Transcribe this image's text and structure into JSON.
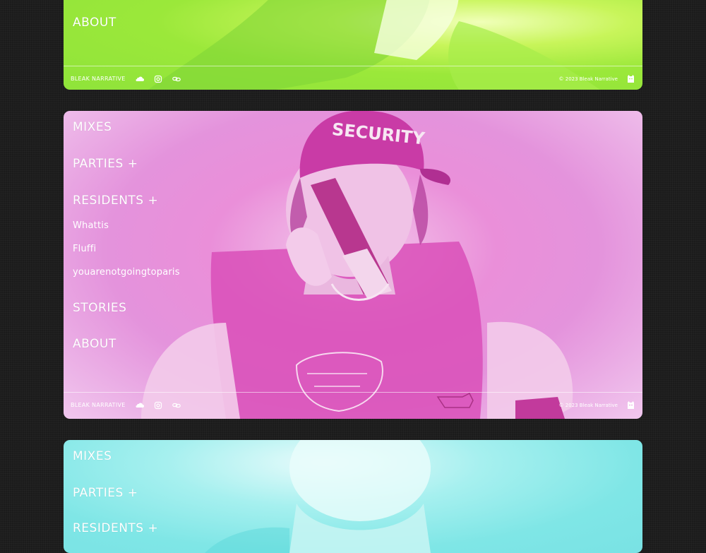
{
  "nav": {
    "mixes": "MIXES",
    "parties": "PARTIES +",
    "residents": "RESIDENTS +",
    "stories": "STORIES",
    "about": "ABOUT",
    "resident_list": [
      "Whattis",
      "Fluffi",
      "youarenotgoingtoparis"
    ]
  },
  "footer": {
    "brand": "BLEAK NARRATIVE",
    "copyright": "© 2023 Bleak Narrative"
  },
  "photo": {
    "cap_text": "SECURITY"
  },
  "icons": [
    "soundcloud-icon",
    "instagram-icon",
    "link-icon",
    "mascot-icon"
  ],
  "colors": {
    "green_panel": "#9be83a",
    "pink_panel": "#e493dc",
    "cyan_panel": "#7fe6e6",
    "background": "#1b1b1b",
    "text": "#ffffff"
  }
}
